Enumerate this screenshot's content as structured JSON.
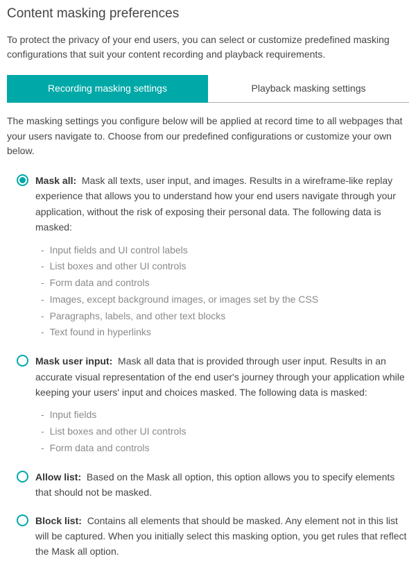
{
  "title": "Content masking preferences",
  "intro": "To protect the privacy of your end users, you can select or customize predefined masking configurations that suit your content recording and playback requirements.",
  "tabs": {
    "recording": "Recording masking settings",
    "playback": "Playback masking settings"
  },
  "tabDescription": "The masking settings you configure below will be applied at record time to all webpages that your users navigate to. Choose from our predefined configurations or customize your own below.",
  "options": {
    "maskAll": {
      "label": "Mask all:",
      "desc": "Mask all texts, user input, and images. Results in a wireframe-like replay experience that allows you to understand how your end users navigate through your application, without the risk of exposing their personal data. The following data is masked:",
      "items": [
        "Input fields and UI control labels",
        "List boxes and other UI controls",
        "Form data and controls",
        "Images, except background images, or images set by the CSS",
        "Paragraphs, labels, and other text blocks",
        "Text found in hyperlinks"
      ]
    },
    "maskUserInput": {
      "label": "Mask user input:",
      "desc": "Mask all data that is provided through user input. Results in an accurate visual representation of the end user's journey through your application while keeping your users' input and choices masked. The following data is masked:",
      "items": [
        "Input fields",
        "List boxes and other UI controls",
        "Form data and controls"
      ]
    },
    "allowList": {
      "label": "Allow list:",
      "desc": "Based on the Mask all option, this option allows you to specify elements that should not be masked."
    },
    "blockList": {
      "label": "Block list:",
      "desc": "Contains all elements that should be masked. Any element not in this list will be captured. When you initially select this masking option, you get rules that reflect the Mask all option."
    }
  }
}
